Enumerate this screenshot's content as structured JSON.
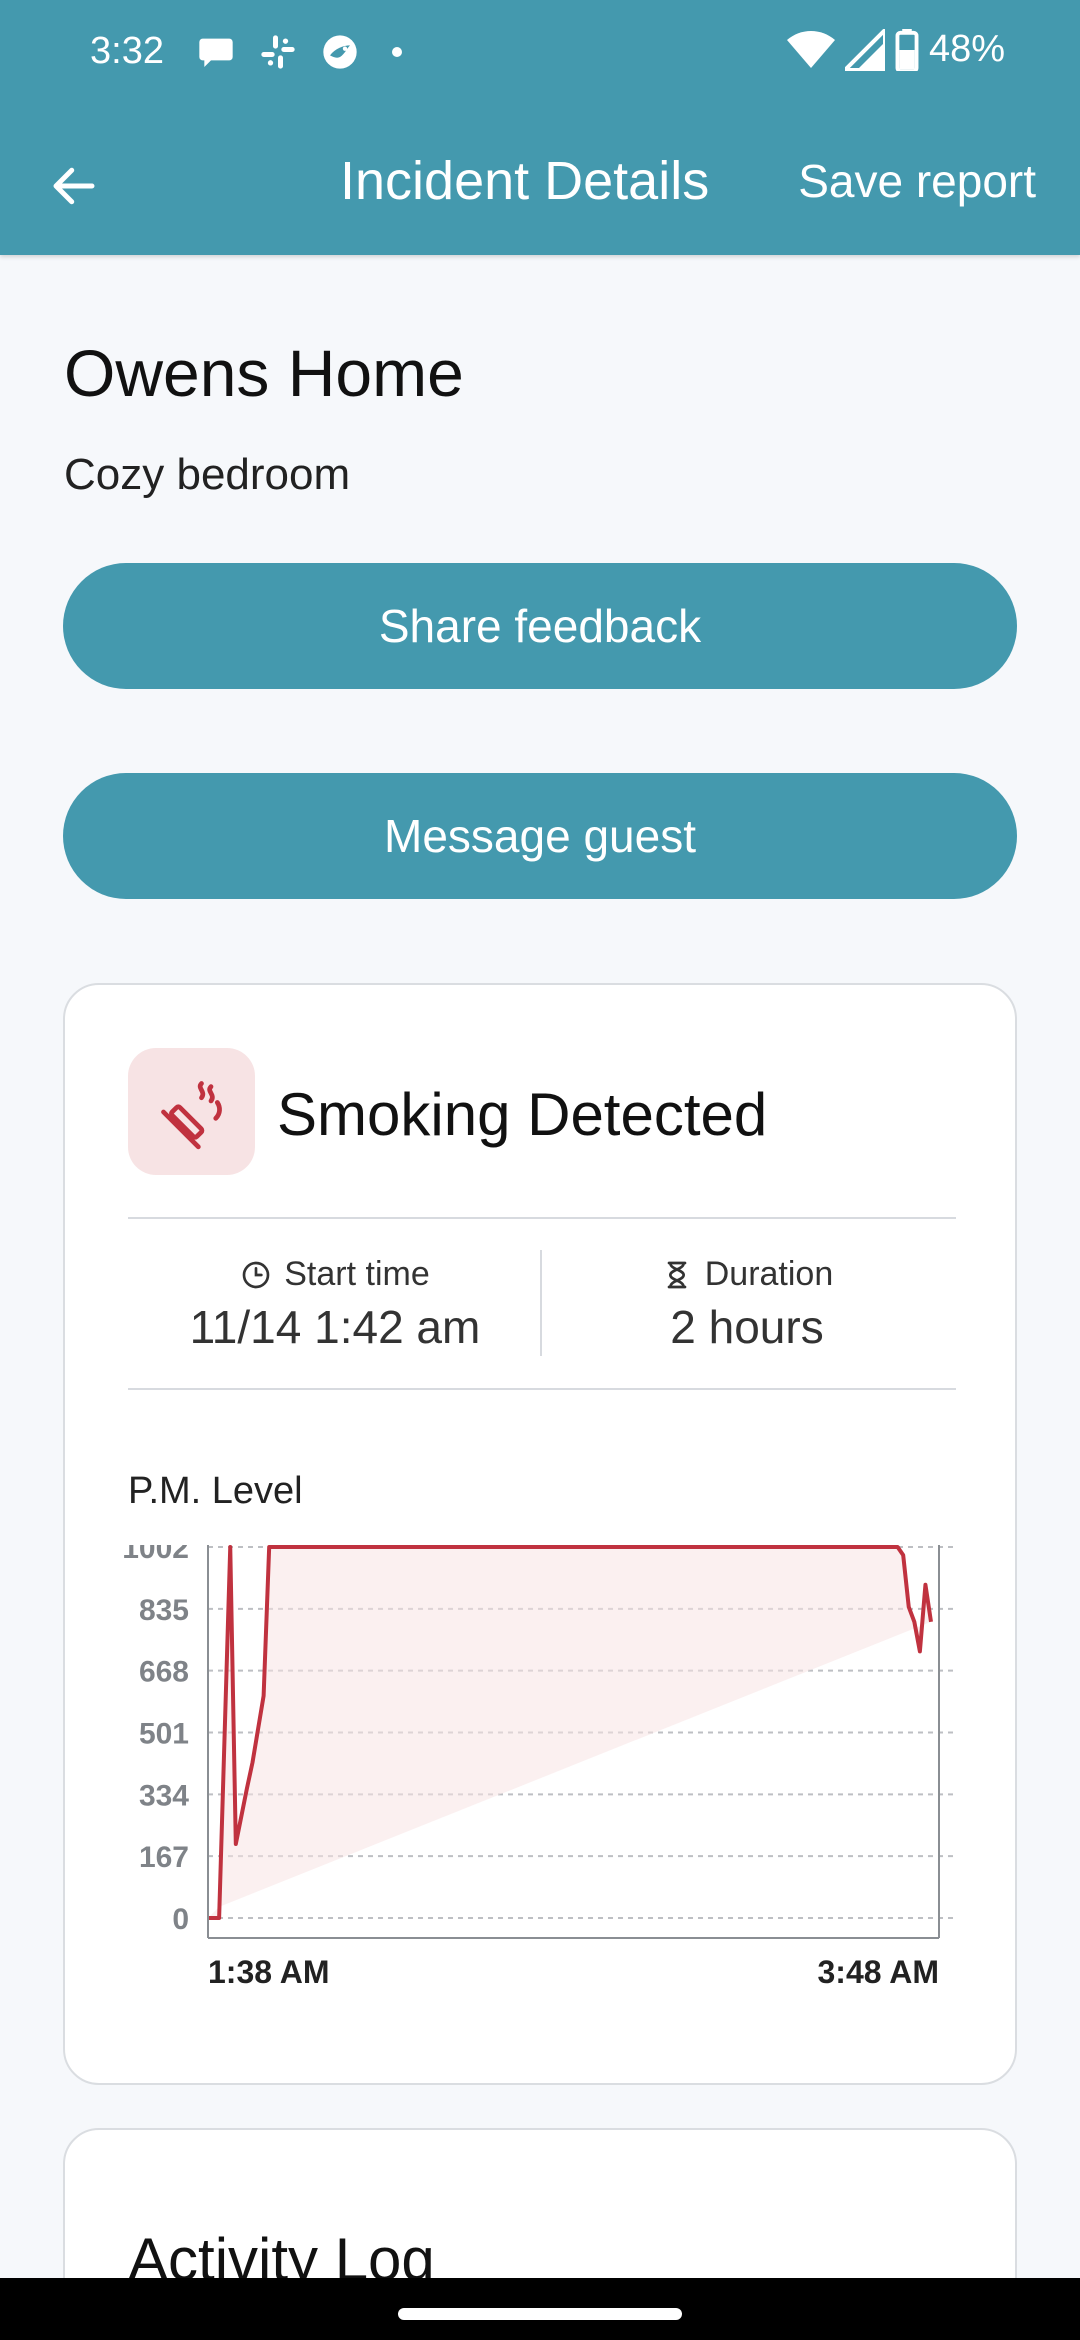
{
  "status_bar": {
    "time": "3:32",
    "battery": "48%",
    "left_icons": [
      "chat-bubble-icon",
      "slack-icon",
      "app-icon",
      "dot-icon"
    ],
    "right_icons": [
      "wifi-icon",
      "signal-icon",
      "battery-icon"
    ]
  },
  "app_bar": {
    "back_icon": "arrow-back-icon",
    "title": "Incident Details",
    "save_label": "Save report"
  },
  "property": {
    "name": "Owens Home",
    "room": "Cozy bedroom"
  },
  "actions": {
    "share_feedback": "Share feedback",
    "message_guest": "Message guest"
  },
  "incident": {
    "icon": "smoking-icon",
    "title": "Smoking Detected",
    "start_label": "Start time",
    "start_value": "11/14 1:42 am",
    "duration_label": "Duration",
    "duration_value": "2 hours",
    "chart_label": "P.M. Level"
  },
  "chart_data": {
    "type": "line",
    "xlabel": "",
    "ylabel": "",
    "x_tick_labels": [
      "1:38 AM",
      "3:48 AM"
    ],
    "y_ticks": [
      0,
      167,
      334,
      501,
      668,
      835,
      1002
    ],
    "ylim": [
      0,
      1002
    ],
    "grid": true,
    "x_minutes": [
      0,
      2,
      4,
      5,
      7,
      8,
      10,
      11,
      12,
      13,
      14,
      124,
      125,
      126,
      127,
      128,
      129,
      130
    ],
    "series": [
      {
        "values": [
          0,
          0,
          1002,
          200,
          350,
          420,
          600,
          1002,
          1002,
          1002,
          1002,
          1002,
          980,
          840,
          800,
          720,
          900,
          800
        ],
        "color": "#C0323F"
      }
    ],
    "series_tail": {
      "note_values": [
        800,
        950,
        850,
        930,
        840,
        820,
        780
      ]
    },
    "fill_color": "#F7E3E4",
    "line_color": "#C0323F"
  },
  "activity": {
    "title": "Activity Log"
  }
}
